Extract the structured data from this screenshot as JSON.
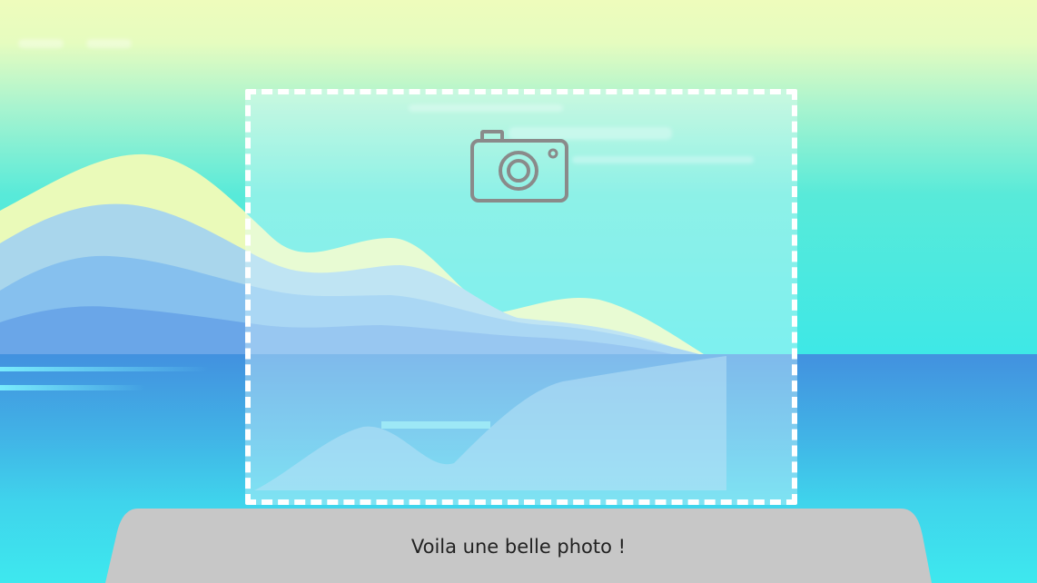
{
  "scene": {
    "caption": "Voila une belle photo !",
    "photo_frame_icon": "camera-icon",
    "colors": {
      "sky_top": "#eefcbc",
      "sky_bottom": "#3ee8e6",
      "sea_top": "#4291df",
      "sea_bottom": "#3ee8ee",
      "hill_yellow": "#eafab9",
      "hill_light_blue": "#a9d6ec",
      "hill_mid_blue": "#7fbdf0",
      "hill_deep_blue": "#6aa8ea",
      "frame_border": "#ffffff",
      "caption_panel": "#c7c7c7",
      "camera_icon": "#8a8a8a"
    }
  }
}
